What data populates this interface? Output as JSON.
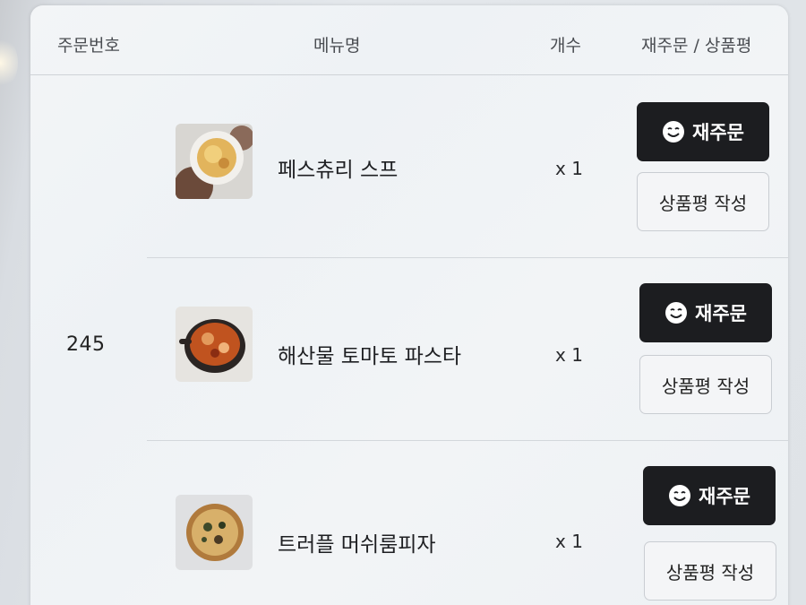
{
  "table": {
    "headers": {
      "order_number": "주문번호",
      "menu_name": "메뉴명",
      "quantity": "개수",
      "action": "재주문 / 상품평"
    },
    "order_number": "245",
    "items": [
      {
        "name": "페스츄리 스프",
        "quantity": "x 1",
        "reorder_label": "재주문",
        "review_label": "상품평 작성",
        "thumbnail": "pastry-soup-photo"
      },
      {
        "name": "해산물 토마토 파스타",
        "quantity": "x 1",
        "reorder_label": "재주문",
        "review_label": "상품평 작성",
        "thumbnail": "seafood-tomato-pasta-photo"
      },
      {
        "name": "트러플 머쉬룸피자",
        "quantity": "x 1",
        "reorder_label": "재주문",
        "review_label": "상품평 작성",
        "thumbnail": "truffle-mushroom-pizza-photo"
      }
    ]
  },
  "colors": {
    "reorder_button_bg": "#1c1d20",
    "review_button_bg": "#f4f5f7"
  }
}
